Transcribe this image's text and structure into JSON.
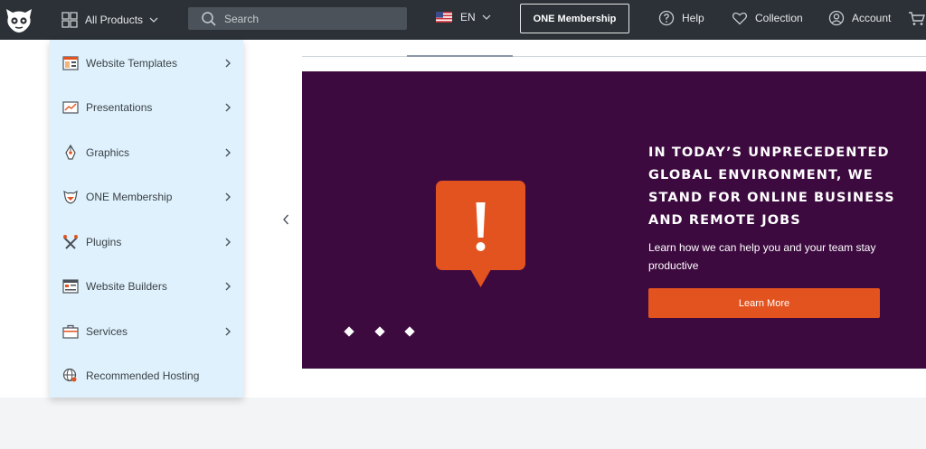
{
  "header": {
    "logo_icon": "monster-logo-icon",
    "all_products": "All Products",
    "search_placeholder": "Search",
    "language": "EN",
    "one_membership": "ONE Membership",
    "help": "Help",
    "collection": "Collection",
    "account": "Account",
    "cart_icon": "cart-icon"
  },
  "menu": {
    "items": [
      {
        "label": "Website Templates",
        "icon": "website-templates-icon",
        "has_arrow": true
      },
      {
        "label": "Presentations",
        "icon": "presentations-icon",
        "has_arrow": true
      },
      {
        "label": "Graphics",
        "icon": "graphics-icon",
        "has_arrow": true
      },
      {
        "label": "ONE Membership",
        "icon": "one-membership-icon",
        "has_arrow": true
      },
      {
        "label": "Plugins",
        "icon": "plugins-icon",
        "has_arrow": true
      },
      {
        "label": "Website Builders",
        "icon": "website-builders-icon",
        "has_arrow": true
      },
      {
        "label": "Services",
        "icon": "services-icon",
        "has_arrow": true
      },
      {
        "label": "Recommended Hosting",
        "icon": "hosting-icon",
        "has_arrow": false
      }
    ]
  },
  "banner": {
    "headline": "IN TODAY’S UNPRECEDENTED GLOBAL ENVIRONMENT, WE STAND FOR ONLINE BUSINESS AND REMOTE JOBS",
    "subtext": "Learn how we can help you and your team stay productive",
    "button": "Learn More",
    "slide_count": 3,
    "colors": {
      "background": "#3d0a40",
      "button": "#e3531f",
      "alert": "#e3531f"
    }
  },
  "colors": {
    "topbar": "#2b3136",
    "dropdown": "#dff1fc"
  }
}
